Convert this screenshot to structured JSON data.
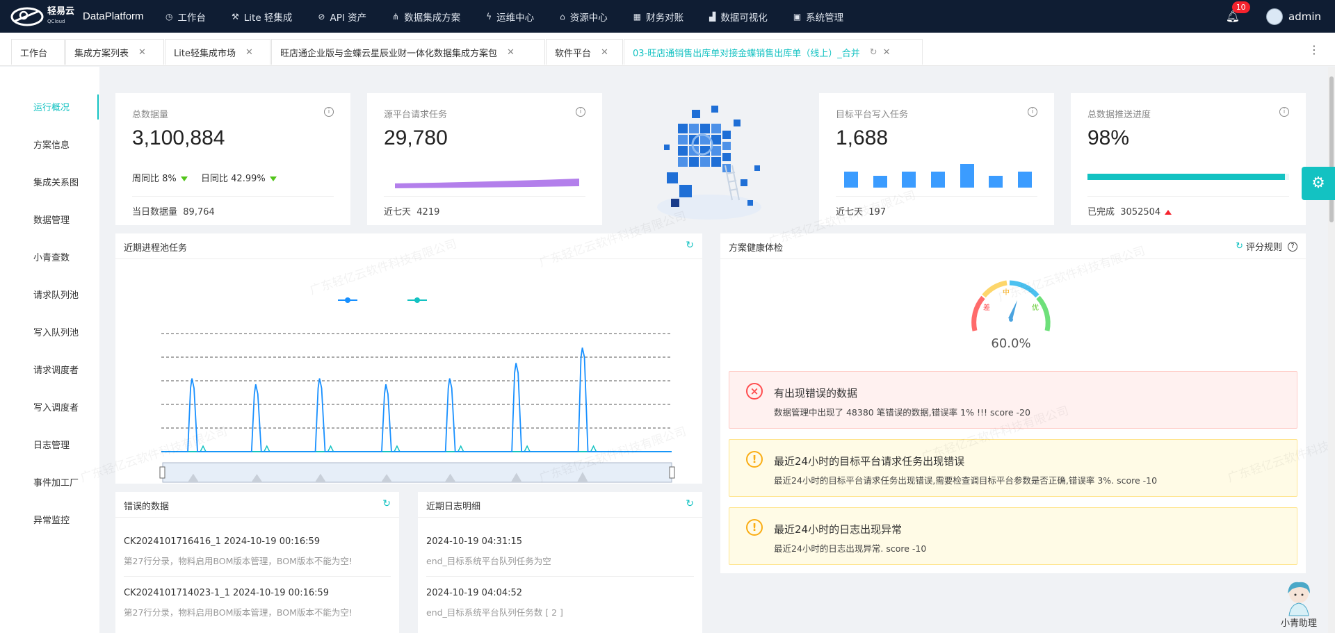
{
  "brand": {
    "logo_text": "轻易云",
    "logo_sub": "QCloud",
    "name": "DataPlatform"
  },
  "topnav": {
    "items": [
      {
        "label": "工作台",
        "icon": "clock-icon"
      },
      {
        "label": "Lite 轻集成",
        "icon": "tool-icon"
      },
      {
        "label": "API 资产",
        "icon": "compass-icon"
      },
      {
        "label": "数据集成方案",
        "icon": "nodes-icon"
      },
      {
        "label": "运维中心",
        "icon": "bolt-icon"
      },
      {
        "label": "资源中心",
        "icon": "sitemap-icon"
      },
      {
        "label": "财务对账",
        "icon": "grid-icon"
      },
      {
        "label": "数据可视化",
        "icon": "chart-icon"
      },
      {
        "label": "系统管理",
        "icon": "apps-icon"
      }
    ],
    "notifications": "10",
    "user": "admin"
  },
  "tabs": [
    {
      "label": "工作台"
    },
    {
      "label": "集成方案列表"
    },
    {
      "label": "Lite轻集成市场"
    },
    {
      "label": "旺店通企业版与金蝶云星辰业财一体化数据集成方案包"
    },
    {
      "label": "软件平台"
    },
    {
      "label": "03-旺店通销售出库单对接金蝶销售出库单（线上）_合并"
    }
  ],
  "sidebar": [
    {
      "label": "运行概况"
    },
    {
      "label": "方案信息"
    },
    {
      "label": "集成关系图"
    },
    {
      "label": "数据管理"
    },
    {
      "label": "小青查数"
    },
    {
      "label": "请求队列池"
    },
    {
      "label": "写入队列池"
    },
    {
      "label": "请求调度者"
    },
    {
      "label": "写入调度者"
    },
    {
      "label": "日志管理"
    },
    {
      "label": "事件加工厂"
    },
    {
      "label": "异常监控"
    }
  ],
  "stats": {
    "total": {
      "title": "总数据量",
      "value": "3,100,884",
      "wow_label": "周同比",
      "wow": "8%",
      "dod_label": "日同比",
      "dod": "42.99%",
      "foot_label": "当日数据量",
      "foot_value": "89,764"
    },
    "source": {
      "title": "源平台请求任务",
      "value": "29,780",
      "foot_label": "近七天",
      "foot_value": "4219"
    },
    "target": {
      "title": "目标平台写入任务",
      "value": "1,688",
      "foot_label": "近七天",
      "foot_value": "197",
      "bars": [
        4,
        3,
        4,
        4,
        6,
        3,
        4
      ]
    },
    "progress": {
      "title": "总数据推送进度",
      "value": "98%",
      "percent": 98,
      "foot_label": "已完成",
      "foot_value": "3052504"
    }
  },
  "pool_panel": {
    "title": "近期进程池任务"
  },
  "chart_data": {
    "type": "line",
    "series": [
      {
        "color": "#1890ff",
        "values": [
          0,
          0,
          0,
          0,
          0,
          0,
          0,
          0,
          0,
          0,
          0,
          0,
          0,
          0,
          0,
          0,
          0,
          0,
          0,
          0,
          0,
          0,
          0,
          0,
          0,
          0,
          0,
          0,
          0,
          0,
          0,
          0,
          0,
          0,
          0,
          0,
          0,
          0,
          0,
          0,
          0,
          0,
          0,
          0,
          0,
          0,
          0,
          0,
          0,
          0,
          0,
          0,
          0,
          0,
          0,
          0,
          0,
          0,
          0,
          0,
          0,
          0,
          0,
          0,
          0,
          0,
          0,
          0,
          0,
          0,
          0,
          0,
          0,
          0,
          0,
          0,
          0,
          0,
          0,
          0,
          0,
          0,
          0,
          0,
          0,
          0,
          0,
          0,
          0,
          0,
          0,
          0,
          0,
          0,
          0,
          0,
          0,
          0,
          0,
          0,
          0,
          0,
          0,
          0,
          0,
          0,
          0,
          0,
          0,
          0,
          0,
          0,
          0,
          0,
          0,
          0,
          0,
          0,
          0,
          0
        ]
      },
      {
        "color": "#13c2c2",
        "values": []
      }
    ],
    "peaks": [
      {
        "x": 0.06,
        "y": 62
      },
      {
        "x": 0.185,
        "y": 57
      },
      {
        "x": 0.31,
        "y": 62
      },
      {
        "x": 0.44,
        "y": 57
      },
      {
        "x": 0.565,
        "y": 62
      },
      {
        "x": 0.695,
        "y": 75
      },
      {
        "x": 0.825,
        "y": 88
      }
    ],
    "ylim": [
      0,
      100
    ],
    "grid": true
  },
  "health": {
    "title": "方案健康体检",
    "rule": "评分规则",
    "score": "60.0%",
    "score_value": 60,
    "labels": {
      "bad": "差",
      "mid": "中",
      "good": "优"
    },
    "alerts": [
      {
        "type": "error",
        "title": "有出现错误的数据",
        "desc": "数据管理中出现了 48380 笔错误的数据,错误率 1% !!! score -20"
      },
      {
        "type": "warning",
        "title": "最近24小时的目标平台请求任务出现错误",
        "desc": "最近24小时的目标平台请求任务出现错误,需要检查调目标平台参数是否正确,错误率 3%. score -10"
      },
      {
        "type": "warning",
        "title": "最近24小时的日志出现异常",
        "desc": "最近24小时的日志出现异常. score -10"
      }
    ]
  },
  "errors": {
    "title": "错误的数据",
    "items": [
      {
        "id": "CK2024101716416_1 2024-10-19 00:16:59",
        "msg": "第27行分录，物料启用BOM版本管理，BOM版本不能为空!"
      },
      {
        "id": "CK2024101714023-1_1 2024-10-19 00:16:59",
        "msg": "第27行分录，物料启用BOM版本管理，BOM版本不能为空!"
      }
    ]
  },
  "logs": {
    "title": "近期日志明细",
    "items": [
      {
        "time": "2024-10-19 04:31:15",
        "msg": "end_目标系统平台队列任务为空"
      },
      {
        "time": "2024-10-19 04:04:52",
        "msg": "end_目标系统平台队列任务数 [ 2 ]"
      }
    ]
  },
  "assistant": {
    "label": "小青助理"
  },
  "watermark": "广东轻亿云软件科技有限公司"
}
